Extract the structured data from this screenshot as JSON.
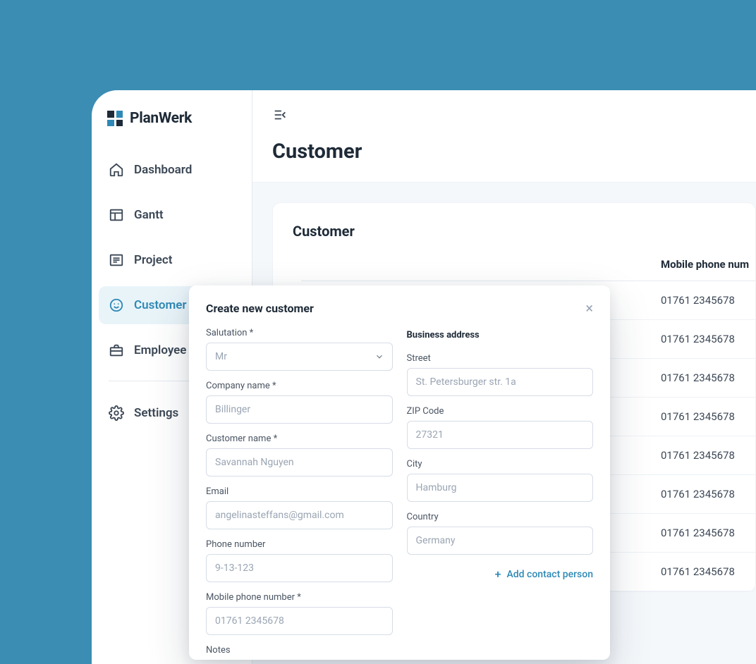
{
  "brand": {
    "name": "PlanWerk"
  },
  "sidebar": {
    "items": [
      {
        "key": "dashboard",
        "label": "Dashboard"
      },
      {
        "key": "gantt",
        "label": "Gantt"
      },
      {
        "key": "project",
        "label": "Project"
      },
      {
        "key": "customer",
        "label": "Customer"
      },
      {
        "key": "employee",
        "label": "Employee"
      },
      {
        "key": "settings",
        "label": "Settings"
      }
    ]
  },
  "page": {
    "title": "Customer",
    "card_title": "Customer"
  },
  "table": {
    "columns": {
      "mobile": "Mobile phone num"
    },
    "rows": [
      {
        "mobile": "01761 2345678"
      },
      {
        "mobile": "01761 2345678"
      },
      {
        "mobile": "01761 2345678"
      },
      {
        "mobile": "01761 2345678"
      },
      {
        "mobile": "01761 2345678"
      },
      {
        "mobile": "01761 2345678"
      },
      {
        "mobile": "01761 2345678"
      },
      {
        "mobile": "01761 2345678"
      }
    ]
  },
  "modal": {
    "title": "Create new customer",
    "labels": {
      "salutation": "Salutation *",
      "company": "Company name *",
      "customer_name": "Customer name *",
      "email": "Email",
      "phone": "Phone number",
      "mobile": "Mobile phone number *",
      "notes": "Notes",
      "business_address": "Business address",
      "street": "Street",
      "zip": "ZIP Code",
      "city": "City",
      "country": "Country"
    },
    "placeholders": {
      "salutation": "Mr",
      "company": "Billinger",
      "customer_name": "Savannah Nguyen",
      "email": "angelinasteffans@gmail.com",
      "phone": "9-13-123",
      "mobile": "01761 2345678",
      "street": "St. Petersburger str. 1a",
      "zip": "27321",
      "city": "Hamburg",
      "country": "Germany"
    },
    "add_contact": "Add contact person"
  }
}
